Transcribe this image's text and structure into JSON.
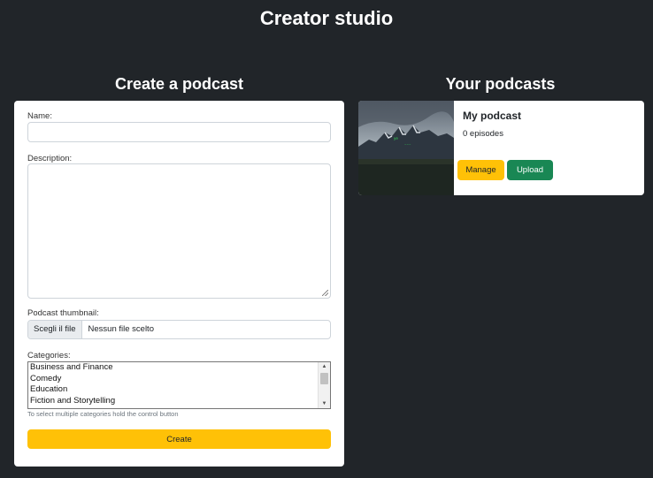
{
  "header": {
    "title": "Creator studio"
  },
  "create_section": {
    "title": "Create a podcast",
    "name_label": "Name:",
    "name_value": "",
    "description_label": "Description:",
    "description_value": "",
    "thumbnail_label": "Podcast thumbnail:",
    "file_button_label": "Scegli il file",
    "file_status": "Nessun file scelto",
    "categories_label": "Categories:",
    "categories": [
      "Business and Finance",
      "Comedy",
      "Education",
      "Fiction and Storytelling"
    ],
    "categories_hint": "To select multiple categories hold the control button",
    "create_button_label": "Create"
  },
  "podcasts_section": {
    "title": "Your podcasts",
    "podcasts": [
      {
        "name": "My podcast",
        "episodes": "0 episodes",
        "manage_label": "Manage",
        "upload_label": "Upload",
        "thumbnail_icon": "mountain-landscape-thumbnail"
      }
    ]
  },
  "colors": {
    "background": "#212529",
    "warning": "#ffc107",
    "success": "#198754"
  }
}
